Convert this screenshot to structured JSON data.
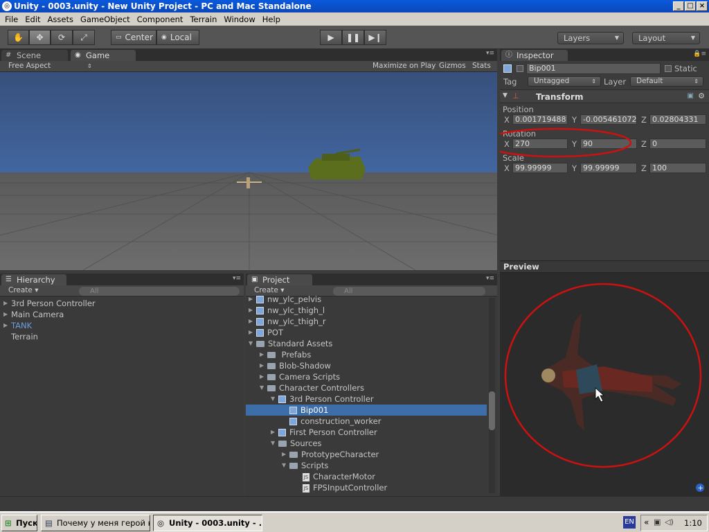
{
  "window": {
    "title": "Unity - 0003.unity - New Unity Project - PC and Mac Standalone"
  },
  "menu": [
    "File",
    "Edit",
    "Assets",
    "GameObject",
    "Component",
    "Terrain",
    "Window",
    "Help"
  ],
  "toolbar": {
    "pivot": "Center",
    "space": "Local",
    "layers": "Layers",
    "layout": "Layout"
  },
  "scene_tab": "Scene",
  "game_tab": "Game",
  "game_bar": {
    "aspect": "Free Aspect",
    "maximize": "Maximize on Play",
    "gizmos": "Gizmos",
    "stats": "Stats"
  },
  "inspector": {
    "tab": "Inspector",
    "object_name": "Bip001",
    "static": "Static",
    "tag_label": "Tag",
    "tag": "Untagged",
    "layer_label": "Layer",
    "layer": "Default",
    "component": "Transform",
    "position_label": "Position",
    "position": {
      "x": "0.001719488",
      "y": "-0.005461072",
      "z": "0.02804331"
    },
    "rotation_label": "Rotation",
    "rotation": {
      "x": "270",
      "y": "90",
      "z": "0"
    },
    "scale_label": "Scale",
    "scale": {
      "x": "99.99999",
      "y": "99.99999",
      "z": "100"
    },
    "preview": "Preview"
  },
  "hierarchy": {
    "tab": "Hierarchy",
    "create": "Create",
    "search": "All",
    "items": [
      "3rd Person Controller",
      "Main Camera",
      "TANK",
      "Terrain"
    ]
  },
  "project": {
    "tab": "Project",
    "create": "Create",
    "search": "All",
    "items": [
      "nw_ylc_pelvis",
      "nw_ylc_thigh_l",
      "nw_ylc_thigh_r",
      "POT",
      "Standard Assets",
      "Prefabs",
      "Blob-Shadow",
      "Camera Scripts",
      "Character Controllers",
      "3rd Person Controller",
      "Bip001",
      "construction_worker",
      "First Person Controller",
      "Sources",
      "PrototypeCharacter",
      "Scripts",
      "CharacterMotor",
      "FPSInputController"
    ]
  },
  "taskbar": {
    "start": "Пуск",
    "task1": "Почему у меня герой ку...",
    "task2": "Unity - 0003.unity - ...",
    "lang": "EN",
    "time": "1:10"
  },
  "colors": {
    "accent_red": "#cc1111",
    "selection": "#3d6eaa",
    "tank_color": "#5a6e1e"
  }
}
